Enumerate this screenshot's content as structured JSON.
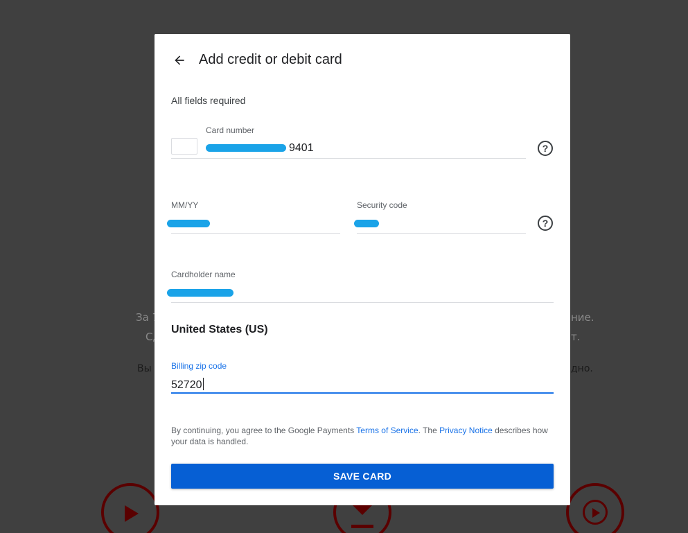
{
  "background": {
    "line1_left": "За 7",
    "line1_right": "ние.",
    "line2_left": "Сд",
    "line2_right": "т.",
    "line3_left": "Вы",
    "line3_right": "дно."
  },
  "dialog": {
    "title": "Add credit or debit card",
    "required_note": "All fields required",
    "card_number": {
      "label": "Card number",
      "value_suffix": "9401"
    },
    "expiry": {
      "label": "MM/YY"
    },
    "security_code": {
      "label": "Security code"
    },
    "cardholder": {
      "label": "Cardholder name"
    },
    "country": "United States (US)",
    "zip": {
      "label": "Billing zip code",
      "value": "52720"
    },
    "terms": {
      "prefix": "By continuing, you agree to the Google Payments ",
      "tos_link": "Terms of Service",
      "middle": ". The ",
      "privacy_link": "Privacy Notice",
      "suffix": " describes how your data is handled."
    },
    "save_label": "SAVE CARD",
    "help_glyph": "?"
  },
  "colors": {
    "accent": "#065fd4",
    "link": "#1a73e8",
    "redaction": "#1aa3e8",
    "overlay": "#404040"
  }
}
